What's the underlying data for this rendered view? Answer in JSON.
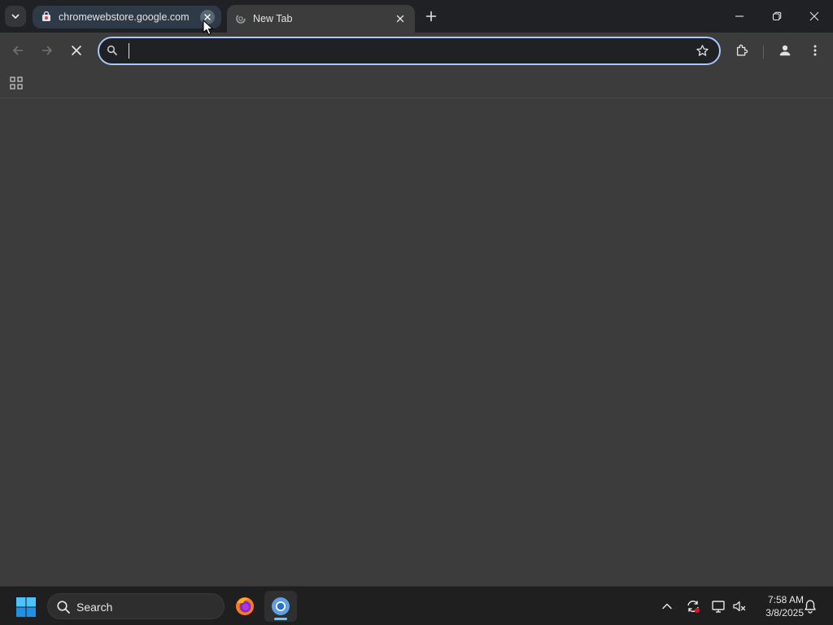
{
  "browser": {
    "tabs": [
      {
        "title": "chromewebstore.google.com",
        "favicon": "chrome-web-store-icon",
        "state": "inactive"
      },
      {
        "title": "New Tab",
        "favicon": "loading-spinner-icon",
        "state": "active"
      }
    ],
    "window_controls": [
      "minimize-icon",
      "restore-icon",
      "close-icon"
    ]
  },
  "toolbar": {
    "omnibox": {
      "value": "",
      "placeholder": ""
    },
    "buttons": [
      "back-icon",
      "forward-icon",
      "stop-loading-icon",
      "bookmark-star-icon",
      "extensions-icon",
      "profile-icon",
      "menu-icon"
    ]
  },
  "bookmarks_bar": {
    "apps_icon": "apps-grid-icon"
  },
  "taskbar": {
    "search_label": "Search",
    "pinned": [
      "firefox-icon",
      "chrome-icon"
    ],
    "tray": [
      "show-hidden-icons-chevron",
      "sync-icon",
      "display-icon",
      "network-sound-icon",
      "notification-bell-icon"
    ],
    "time": "7:58 AM",
    "date": "3/8/2025"
  },
  "colors": {
    "tabstrip": "#202124",
    "toolbar": "#3c3c3c",
    "omnibox_border": "#a8c7fa",
    "inactive_tab": "#2f3a48",
    "taskbar": "#1f1f1f",
    "accent": "#60cdff"
  }
}
